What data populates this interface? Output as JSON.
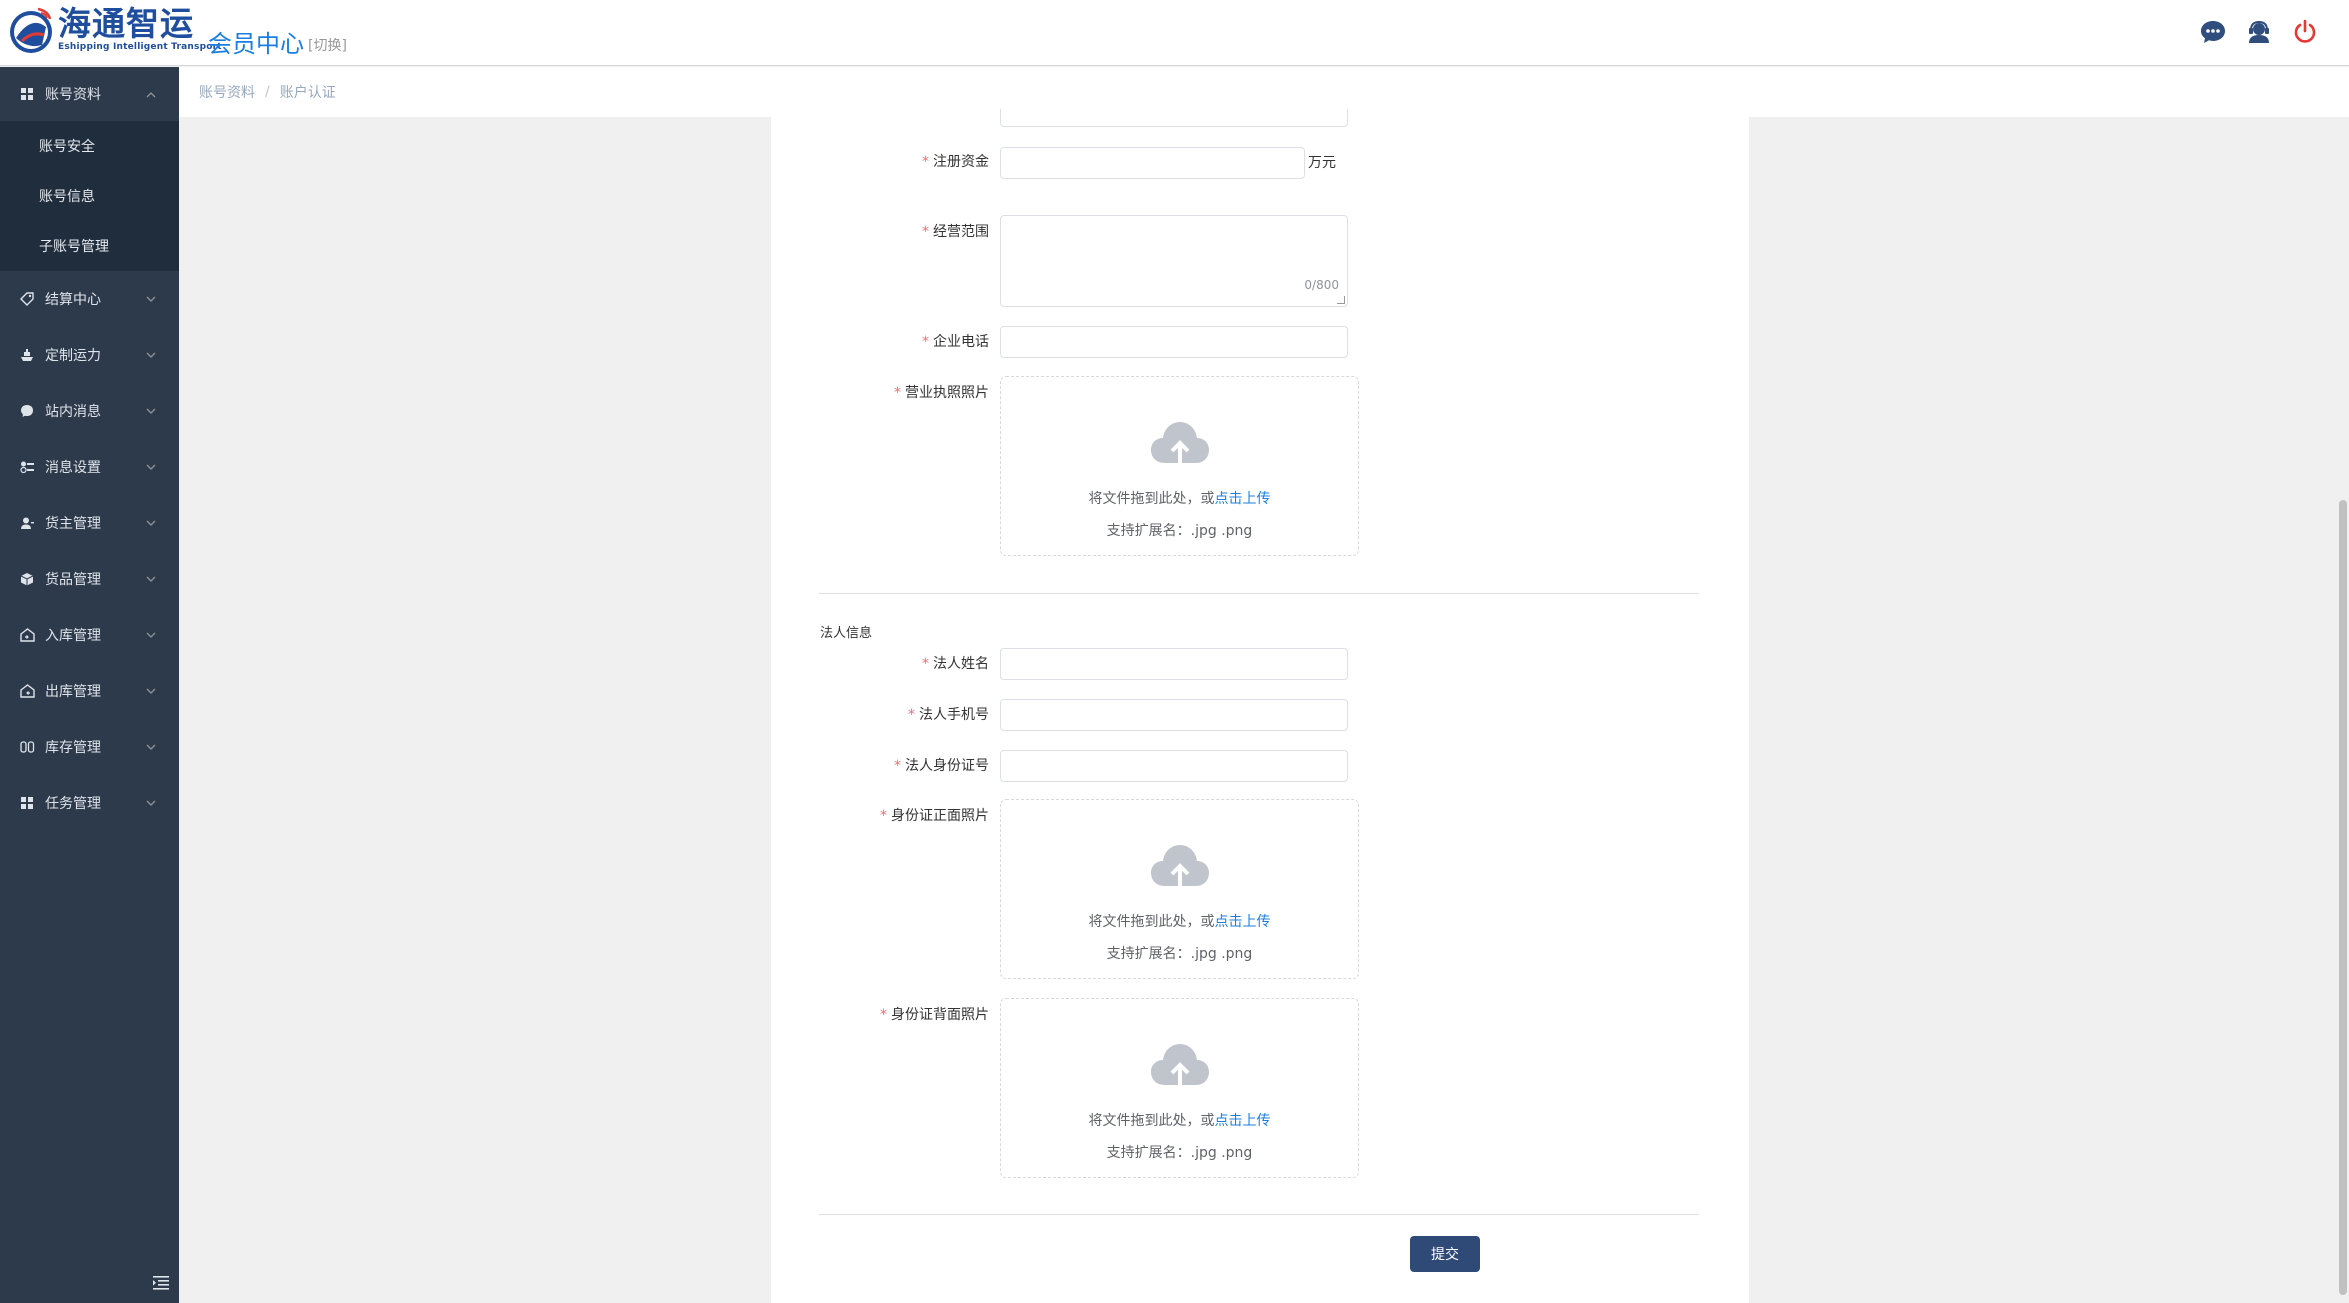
{
  "header": {
    "logo_cn": "海通智运",
    "logo_en": "Eshipping Intelligent Transport",
    "title": "会员中心",
    "switch_label": "[切换]",
    "icons": [
      "chat-icon",
      "customer-service-icon",
      "power-icon"
    ]
  },
  "sidebar": {
    "items": [
      {
        "label": "账号资料",
        "icon": "grid-icon",
        "expanded": true
      },
      {
        "label": "结算中心",
        "icon": "tag-icon"
      },
      {
        "label": "定制运力",
        "icon": "ship-icon"
      },
      {
        "label": "站内消息",
        "icon": "chat-bubble-icon"
      },
      {
        "label": "消息设置",
        "icon": "settings-list-icon"
      },
      {
        "label": "货主管理",
        "icon": "user-icon"
      },
      {
        "label": "货品管理",
        "icon": "box-icon"
      },
      {
        "label": "入库管理",
        "icon": "warehouse-in-icon"
      },
      {
        "label": "出库管理",
        "icon": "warehouse-out-icon"
      },
      {
        "label": "库存管理",
        "icon": "inventory-icon"
      },
      {
        "label": "任务管理",
        "icon": "grid-icon"
      }
    ],
    "subitems": [
      "账号安全",
      "账号信息",
      "子账号管理"
    ]
  },
  "breadcrumb": {
    "items": [
      "账号资料",
      "账户认证"
    ],
    "separator": "/"
  },
  "form": {
    "registered_capital_label": "注册资金",
    "registered_capital_unit": "万元",
    "business_scope_label": "经营范围",
    "business_scope_counter": "0/800",
    "company_phone_label": "企业电话",
    "business_license_label": "营业执照照片",
    "legal_section_title": "法人信息",
    "legal_name_label": "法人姓名",
    "legal_phone_label": "法人手机号",
    "legal_id_label": "法人身份证号",
    "id_front_label": "身份证正面照片",
    "id_back_label": "身份证背面照片",
    "upload_hint": "将文件拖到此处，或",
    "upload_link": "点击上传",
    "upload_ext": "支持扩展名：.jpg .png",
    "submit_label": "提交"
  },
  "colors": {
    "sidebar_bg": "#2d3a4b",
    "submenu_bg": "#1f2d3d",
    "accent": "#1a7fe0",
    "submit_bg": "#304a78",
    "required": "#f56c6c"
  }
}
